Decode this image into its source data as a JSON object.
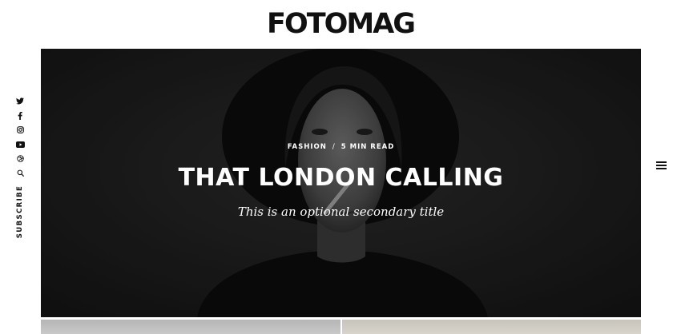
{
  "site": {
    "logo_text": "FOTOMAG"
  },
  "social": {
    "icons": [
      "twitter-icon",
      "facebook-icon",
      "instagram-icon",
      "youtube-icon",
      "dribbble-icon",
      "search-icon"
    ],
    "subscribe_label": "SUBSCRIBE"
  },
  "hero": {
    "category": "FASHION",
    "separator": "/",
    "read_time": "5 MIN READ",
    "title": "THAT LONDON CALLING",
    "subtitle": "This is an optional secondary title"
  },
  "menu": {
    "icon": "hamburger-menu-icon"
  },
  "colors": {
    "text": "#111111",
    "hero_overlay": "#141414",
    "hero_text": "#ffffff"
  }
}
